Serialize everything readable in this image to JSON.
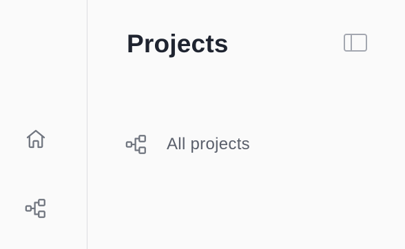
{
  "sidebar": {
    "items": [
      {
        "icon": "home-icon"
      },
      {
        "icon": "project-tree-icon"
      }
    ]
  },
  "panel": {
    "title": "Projects",
    "toggle_icon": "sidebar-toggle-icon",
    "nav": [
      {
        "label": "All projects",
        "icon": "project-tree-icon"
      }
    ]
  },
  "colors": {
    "background": "#fafafa",
    "title": "#1f2430",
    "label": "#5a5f6b",
    "icon": "#70757f",
    "divider": "#dcdde0"
  }
}
